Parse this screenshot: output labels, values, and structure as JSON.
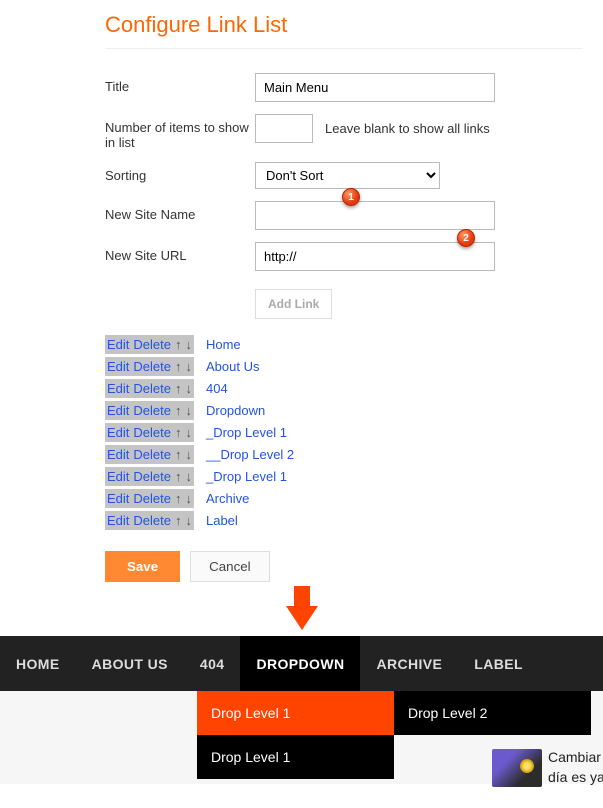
{
  "pageTitle": "Configure Link List",
  "form": {
    "titleLabel": "Title",
    "titleValue": "Main Menu",
    "numberLabel": "Number of items to show in list",
    "numberValue": "",
    "numberHelper": "Leave blank to show all links",
    "sortingLabel": "Sorting",
    "sortingValue": "Don't Sort",
    "newSiteNameLabel": "New Site Name",
    "newSiteNameValue": "",
    "newSiteUrlLabel": "New Site URL",
    "newSiteUrlValue": "http://",
    "addLink": "Add Link",
    "badge1": "1",
    "badge2": "2"
  },
  "links": {
    "edit": "Edit",
    "delete": "Delete",
    "up": "↑",
    "down": "↓",
    "items": [
      {
        "label": "Home"
      },
      {
        "label": "About Us"
      },
      {
        "label": "404"
      },
      {
        "label": "Dropdown"
      },
      {
        "label": "_Drop Level 1"
      },
      {
        "label": "__Drop Level 2"
      },
      {
        "label": "_Drop Level 1"
      },
      {
        "label": "Archive"
      },
      {
        "label": "Label"
      }
    ]
  },
  "buttons": {
    "save": "Save",
    "cancel": "Cancel"
  },
  "nav": {
    "items": [
      {
        "label": "HOME",
        "active": false
      },
      {
        "label": "ABOUT US",
        "active": false
      },
      {
        "label": "404",
        "active": false
      },
      {
        "label": "DROPDOWN",
        "active": true
      },
      {
        "label": "ARCHIVE",
        "active": false
      },
      {
        "label": "LABEL",
        "active": false
      }
    ]
  },
  "submenu": {
    "col1": [
      {
        "label": "Drop Level 1",
        "style": "orange"
      },
      {
        "label": "Drop Level 1",
        "style": "black"
      }
    ],
    "col2": [
      {
        "label": "Drop Level 2",
        "style": "black"
      }
    ]
  },
  "sidebar": {
    "line1": "Cambiar",
    "line2": "día es ya"
  }
}
